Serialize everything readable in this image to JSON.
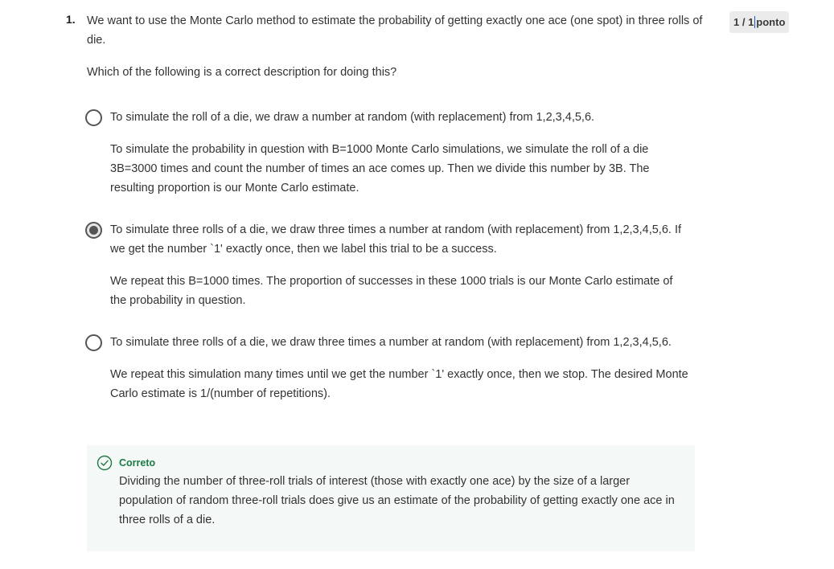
{
  "question": {
    "number": "1.",
    "text": "We want to use the Monte Carlo method to estimate the probability of getting exactly one ace (one spot) in three rolls of die.",
    "subtext": "Which of the following is a correct description for doing this?"
  },
  "score": {
    "value": "1 / 1",
    "unit": "ponto"
  },
  "options": [
    {
      "selected": false,
      "line1": "To simulate the roll of a die, we draw a number at random (with replacement) from  1,2,3,4,5,6.",
      "line2": "To simulate the probability in question with B=1000 Monte Carlo simulations, we simulate the roll of a die 3B=3000 times and count the number of times an ace comes up. Then we divide this number by 3B. The resulting proportion is our Monte Carlo estimate."
    },
    {
      "selected": true,
      "line1": "To simulate three rolls of a die, we draw three times a number at random (with replacement) from 1,2,3,4,5,6.  If we get the number `1' exactly once, then we label this trial to be a success.",
      "line2": "We repeat this B=1000 times. The proportion of successes in these 1000 trials is our Monte Carlo estimate of the probability in question."
    },
    {
      "selected": false,
      "line1": "To simulate three rolls of a die, we draw three times a number at random (with replacement) from 1,2,3,4,5,6.",
      "line2": "We repeat this simulation many times until we get the number `1' exactly once, then we stop. The desired Monte Carlo estimate is 1/(number of repetitions)."
    }
  ],
  "feedback": {
    "icon": "check-circle-icon",
    "title": "Correto",
    "text": "Dividing the number of three-roll trials of interest (those with exactly one ace) by the size of a larger population of random three-roll trials does give us an estimate of the probability of getting exactly one ace in three rolls of a die."
  },
  "colors": {
    "feedback_bg": "#f4f8f6",
    "success_green": "#1e7a45",
    "badge_bg": "#ebebeb"
  }
}
